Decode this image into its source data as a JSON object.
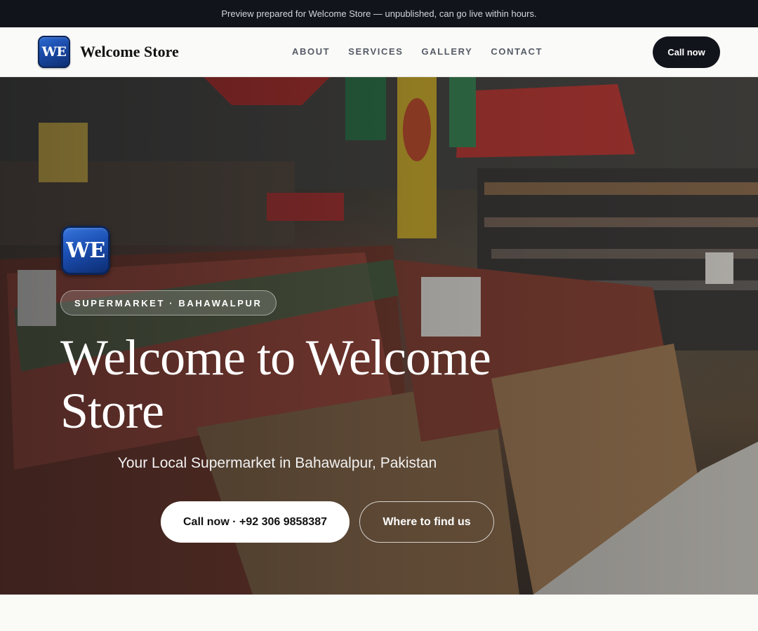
{
  "banner": {
    "text": "Preview prepared for Welcome Store — unpublished, can go live within hours."
  },
  "header": {
    "logo_text": "WE",
    "brand": "Welcome Store",
    "nav": [
      {
        "label": "ABOUT"
      },
      {
        "label": "SERVICES"
      },
      {
        "label": "GALLERY"
      },
      {
        "label": "CONTACT"
      }
    ],
    "cta_label": "Call now"
  },
  "hero": {
    "logo_text": "WE",
    "tag": "SUPERMARKET · BAHAWALPUR",
    "title": "Welcome to Welcome Store",
    "subtitle": "Your Local Supermarket in Bahawalpur, Pakistan",
    "primary_button": "Call now · +92 306 9858387",
    "secondary_button": "Where to find us",
    "background_image": "supermarket-interior-photo"
  },
  "colors": {
    "banner_bg": "#11141b",
    "logo_blue": "#1a4aa8",
    "cta_dark": "#11141b",
    "page_bg": "#fafaf7"
  }
}
